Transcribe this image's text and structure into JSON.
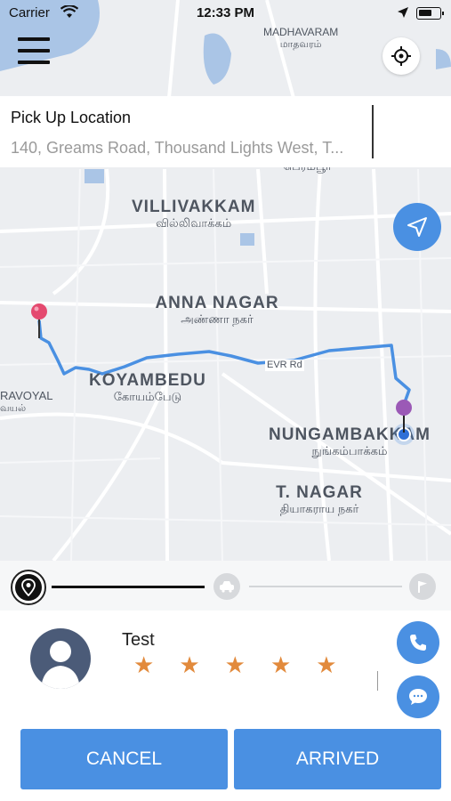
{
  "status_bar": {
    "carrier": "Carrier",
    "time": "12:33 PM"
  },
  "map": {
    "labels": [
      {
        "en": "VILLIVAKKAM",
        "ta": "வில்லிவாக்கம்"
      },
      {
        "en": "ANNA NAGAR",
        "ta": "அண்ணா நகர்"
      },
      {
        "en": "KOYAMBEDU",
        "ta": "கோயம்பேடு"
      },
      {
        "en": "NUNGAMBAKKAM",
        "ta": "நுங்கம்பாக்கம்"
      },
      {
        "en": "T. NAGAR",
        "ta": "தியாகராய நகர்"
      },
      {
        "en": "MADHAVARAM",
        "ta": "மாதவரம்"
      }
    ],
    "road_label": "EVR Rd",
    "partial_labels": {
      "left": "RAVOYAL",
      "left_ta": "வயல்",
      "top_ta": "பெரம்பூர்"
    }
  },
  "pickup": {
    "title": "Pick Up Location",
    "address": "140, Greams Road, Thousand Lights West, T..."
  },
  "driver": {
    "name": "Test",
    "rating": 5
  },
  "actions": {
    "cancel": "CANCEL",
    "arrived": "ARRIVED"
  },
  "colors": {
    "accent": "#4a90e2",
    "star": "#e28a3c",
    "route": "#4a90e2",
    "pickup_pin": "#e4496f",
    "dropoff_pin": "#9b59b6"
  }
}
